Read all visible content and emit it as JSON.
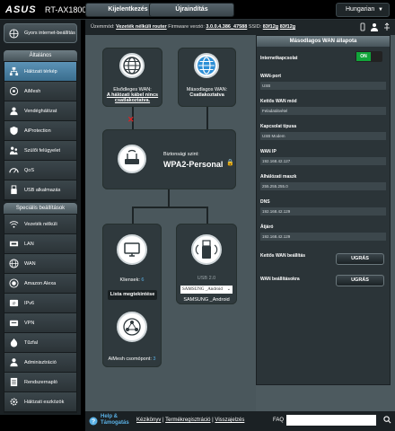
{
  "app": {
    "brand": "ASUS",
    "model": "RT-AX1800U",
    "top_tabs": [
      "Kijelentkezés",
      "Újraindítás"
    ],
    "language": "Hungarian"
  },
  "sidebar": {
    "quick_setup": "Gyors internet-beállítás",
    "general_header": "Általános",
    "general_items": [
      "Hálózati térkép",
      "AiMesh",
      "Vendéghálózat",
      "AiProtection",
      "Szülői felügyelet",
      "QoS",
      "USB alkalmazás"
    ],
    "advanced_header": "Speciális beállítások",
    "advanced_items": [
      "Vezeték nélküli",
      "LAN",
      "WAN",
      "Amazon Alexa",
      "IPv6",
      "VPN",
      "Tűzfal",
      "Adminisztráció",
      "Rendszernapló",
      "Hálózati eszközök"
    ]
  },
  "status": {
    "mode_label": "Üzemmód:",
    "mode_value": "Vezeték nélküli router",
    "firmware_label": "Firmware verzió:",
    "firmware_value": "3.0.0.4.386_47588",
    "ssid_label": "SSID:",
    "ssid1": "83f12g",
    "ssid2": "83f12g"
  },
  "map": {
    "primary_wan_label": "Elsődleges WAN:",
    "primary_wan_status": "A hálózati kábel nincs csatlakoztatva.",
    "secondary_wan_label": "Másodlagos WAN:",
    "secondary_wan_status": "Csatlakoztatva",
    "security_label": "Biztonsági szint:",
    "security_value": "WPA2-Personal",
    "clients_label": "Kliensek:",
    "clients_count": "6",
    "view_list": "Lista megtekintése",
    "usb_label": "USB 2.0",
    "usb_select": "SAMSUNG _Android",
    "usb_device": "SAMSUNG _Android",
    "aimesh_label": "AiMesh csomópont:",
    "aimesh_count": "3"
  },
  "panel": {
    "title": "Másodlagos WAN állapota",
    "internet_label": "Internetkapcsolat",
    "toggle_state": "ON",
    "fields": [
      {
        "label": "WAN-port",
        "value": "USB"
      },
      {
        "label": "Kettős WAN mód",
        "value": "Feladatátvétel"
      },
      {
        "label": "Kapcsolat típusa",
        "value": "USB Modem"
      },
      {
        "label": "WAN IP",
        "value": "192.168.42.127"
      },
      {
        "label": "Alhálózati maszk",
        "value": "255.255.255.0"
      },
      {
        "label": "DNS",
        "value": "192.168.42.129"
      },
      {
        "label": "Átjáró",
        "value": "192.168.42.129"
      }
    ],
    "dual_wan_label": "Kettős WAN beállítás",
    "wan_settings_label": "WAN beállításokra",
    "go_label": "UGRÁS"
  },
  "footer": {
    "help": "Help & Támogatás",
    "links": [
      "Kézikönyv",
      "Termékregisztráció",
      "Visszajelzés"
    ],
    "faq": "FAQ"
  }
}
